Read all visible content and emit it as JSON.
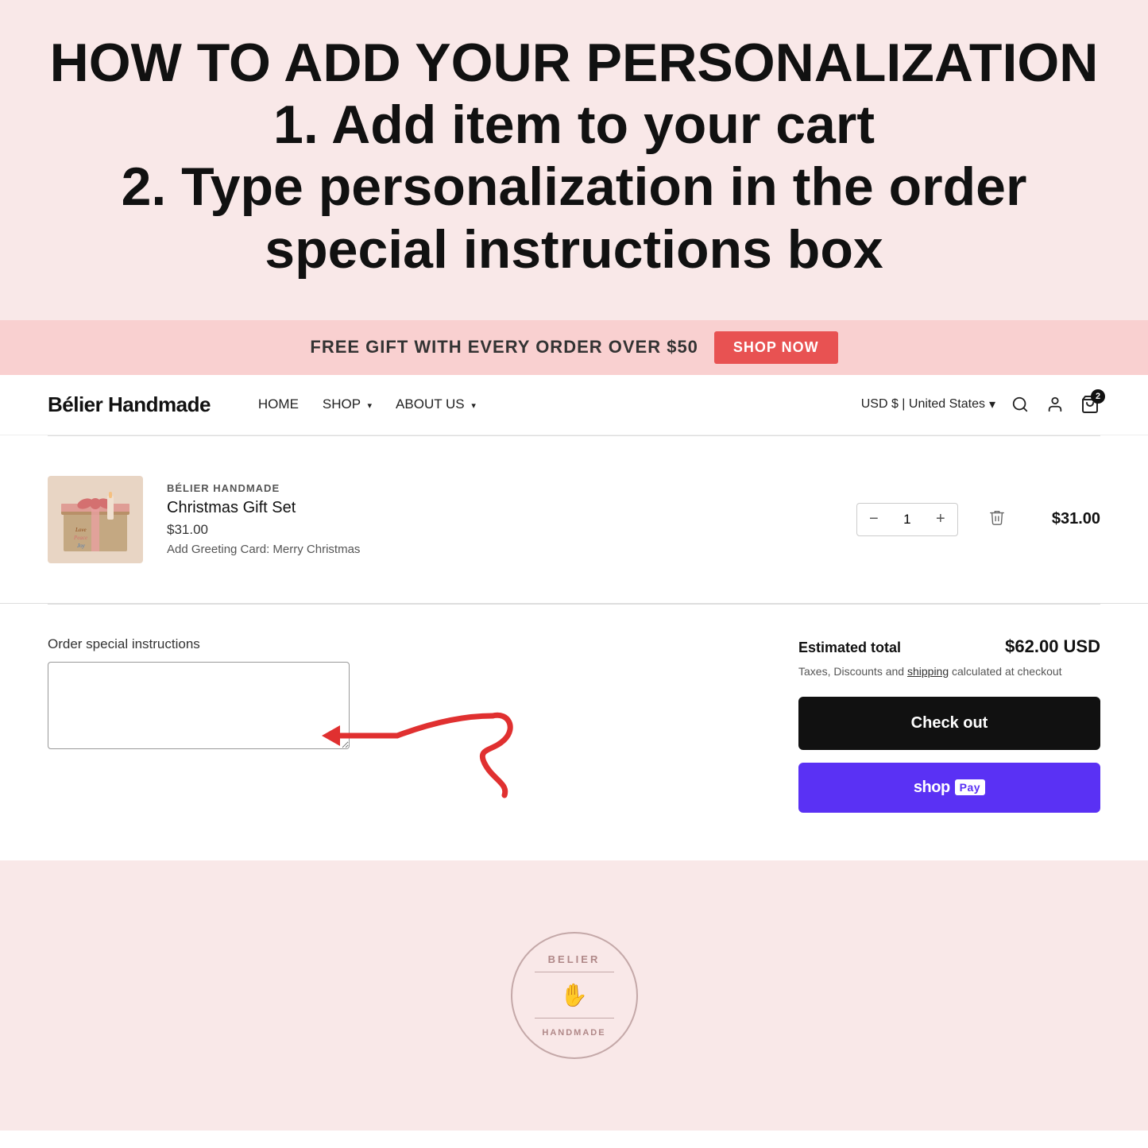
{
  "instruction_banner": {
    "line1": "HOW TO ADD YOUR PERSONALIZATION",
    "line2": "1. Add item to your cart",
    "line3": "2. Type personalization in the order special instructions box"
  },
  "promo_bar": {
    "text": "FREE GIFT WITH EVERY ORDER OVER $50",
    "button_label": "SHOP NOW"
  },
  "navbar": {
    "brand": "Bélier Handmade",
    "links": [
      {
        "label": "HOME",
        "has_dropdown": false
      },
      {
        "label": "SHOP",
        "has_dropdown": true
      },
      {
        "label": "ABOUT US",
        "has_dropdown": true
      }
    ],
    "currency": "USD $ | United States",
    "cart_count": "2"
  },
  "cart": {
    "item": {
      "brand": "BÉLIER HANDMADE",
      "name": "Christmas Gift Set",
      "price": "$31.00",
      "option": "Add Greeting Card: Merry Christmas",
      "quantity": "1",
      "total": "$31.00"
    }
  },
  "order_instructions": {
    "label": "Order special instructions"
  },
  "checkout": {
    "estimated_label": "Estimated total",
    "estimated_amount": "$62.00 USD",
    "tax_note": "Taxes, Discounts and",
    "shipping_link": "shipping",
    "tax_note2": "calculated at checkout",
    "checkout_btn": "Check out",
    "shoppay_text": "shop",
    "shoppay_label": "Pay"
  },
  "footer": {
    "logo_top": "BELIER",
    "logo_bottom": "HANDMADE"
  }
}
